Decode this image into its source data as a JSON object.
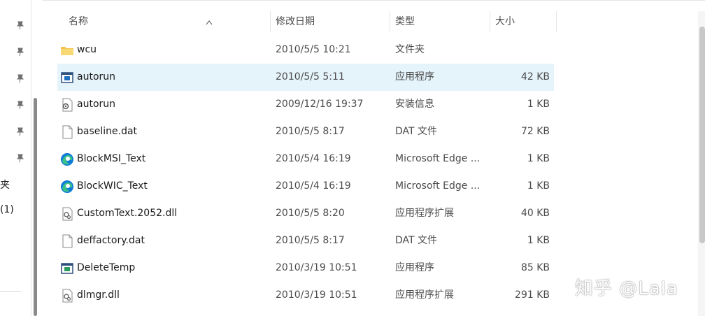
{
  "nav": {
    "item_folder_label": "夹",
    "item_count_label": "(1)"
  },
  "columns": {
    "name": "名称",
    "date": "修改日期",
    "type": "类型",
    "size": "大小"
  },
  "files": [
    {
      "name": "wcu",
      "date": "2010/5/5 10:21",
      "type": "文件夹",
      "size": "",
      "icon": "folder-icon"
    },
    {
      "name": "autorun",
      "date": "2010/5/5 5:11",
      "type": "应用程序",
      "size": "42 KB",
      "icon": "application-icon"
    },
    {
      "name": "autorun",
      "date": "2009/12/16 19:37",
      "type": "安装信息",
      "size": "1 KB",
      "icon": "setup-info-icon"
    },
    {
      "name": "baseline.dat",
      "date": "2010/5/5 8:17",
      "type": "DAT 文件",
      "size": "72 KB",
      "icon": "file-icon"
    },
    {
      "name": "BlockMSI_Text",
      "date": "2010/5/4 16:19",
      "type": "Microsoft Edge ...",
      "size": "1 KB",
      "icon": "edge-icon"
    },
    {
      "name": "BlockWIC_Text",
      "date": "2010/5/4 16:19",
      "type": "Microsoft Edge ...",
      "size": "1 KB",
      "icon": "edge-icon"
    },
    {
      "name": "CustomText.2052.dll",
      "date": "2010/5/5 8:20",
      "type": "应用程序扩展",
      "size": "40 KB",
      "icon": "dll-icon"
    },
    {
      "name": "deffactory.dat",
      "date": "2010/5/5 8:17",
      "type": "DAT 文件",
      "size": "1 KB",
      "icon": "file-icon"
    },
    {
      "name": "DeleteTemp",
      "date": "2010/3/19 10:51",
      "type": "应用程序",
      "size": "85 KB",
      "icon": "application-icon"
    },
    {
      "name": "dlmgr.dll",
      "date": "2010/3/19 10:51",
      "type": "应用程序扩展",
      "size": "291 KB",
      "icon": "dll-icon"
    }
  ],
  "selected_row": 1,
  "watermark": "知乎 @Lala",
  "colors": {
    "selection": "#e5f3fb",
    "folder": "#f4c24a",
    "edge_blue": "#0f7bd8",
    "edge_green": "#3bc28a"
  }
}
